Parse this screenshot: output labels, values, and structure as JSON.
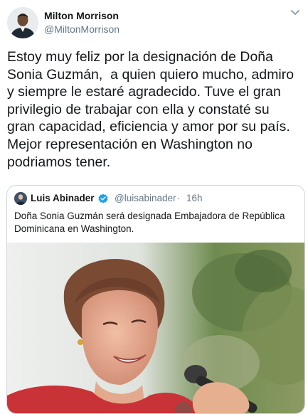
{
  "tweet": {
    "author": {
      "name": "Milton Morrison",
      "handle": "@MiltonMorrison"
    },
    "text": "Estoy muy feliz por la designación de Doña\nSonia Guzmán,  a quien quiero mucho, admiro\ny siempre le estaré agradecido. Tuve el gran\nprivilegio de trabajar con ella y constaté su\ngran capacidad, eficiencia y amor por su país.\nMejor representación en Washington no\npodriamos tener.",
    "quoted_tweet": {
      "author_name": "Luis Abinader",
      "author_handle": "@luisabinader",
      "separator": "·",
      "time": "16h",
      "text": "Doña Sonia Guzmán será designada Embajadora de República Dominicana en Washington.",
      "verified": true
    }
  },
  "colors": {
    "text_primary": "#14171a",
    "text_secondary": "#657786",
    "verified_blue": "#1da1f2",
    "border": "#ccd6dd"
  },
  "icons": {
    "caret": "chevron-down-icon",
    "verified": "verified-badge-icon"
  }
}
